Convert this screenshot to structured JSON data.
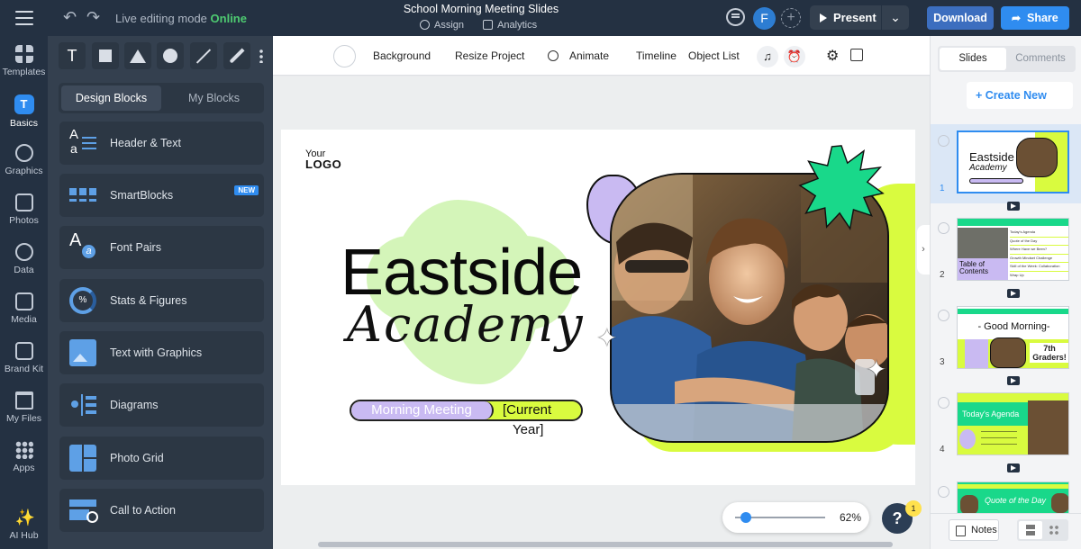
{
  "topbar": {
    "mode_text": "Live editing mode",
    "mode_status": "Online",
    "doc_title": "School Morning Meeting Slides",
    "assign_label": "Assign",
    "analytics_label": "Analytics",
    "avatar_initial": "F",
    "present_label": "Present",
    "download_label": "Download",
    "share_label": "Share"
  },
  "rail": {
    "items": [
      {
        "label": "Templates",
        "icon": "templates-icon"
      },
      {
        "label": "Basics",
        "icon": "basics-icon"
      },
      {
        "label": "Graphics",
        "icon": "graphics-icon"
      },
      {
        "label": "Photos",
        "icon": "photos-icon"
      },
      {
        "label": "Data",
        "icon": "data-icon"
      },
      {
        "label": "Media",
        "icon": "media-icon"
      },
      {
        "label": "Brand Kit",
        "icon": "brand-kit-icon"
      },
      {
        "label": "My Files",
        "icon": "folder-icon"
      },
      {
        "label": "Apps",
        "icon": "apps-icon"
      },
      {
        "label": "AI Hub",
        "icon": "sparkle-icon"
      }
    ]
  },
  "panel": {
    "text_tool": "T",
    "tabs": [
      "Design Blocks",
      "My Blocks"
    ],
    "blocks": [
      {
        "label": "Header & Text"
      },
      {
        "label": "SmartBlocks",
        "badge": "NEW"
      },
      {
        "label": "Font Pairs"
      },
      {
        "label": "Stats & Figures",
        "icon_text": "%"
      },
      {
        "label": "Text with Graphics"
      },
      {
        "label": "Diagrams"
      },
      {
        "label": "Photo Grid"
      },
      {
        "label": "Call to Action"
      }
    ]
  },
  "toolbar": {
    "background": "Background",
    "resize": "Resize Project",
    "animate": "Animate",
    "timeline": "Timeline",
    "object_list": "Object List"
  },
  "slide": {
    "logo_top": "Your",
    "logo_bottom": "LOGO",
    "title_line1": "Eastside",
    "title_line2": "Academy",
    "pill_left": "Morning Meeting",
    "pill_right_1": "[Current",
    "pill_right_2": "Year]"
  },
  "zoom": {
    "value": "62%",
    "level": 0.06
  },
  "help": {
    "label": "?",
    "badge": "1"
  },
  "right_panel": {
    "tabs": [
      "Slides",
      "Comments"
    ],
    "create_new": "+ Create New",
    "slides": [
      {
        "number": "1",
        "title": "Eastside",
        "subtitle": "Academy"
      },
      {
        "number": "2",
        "title": "Table of Contents",
        "items": [
          "Today's Agenda",
          "Quote of the Day",
          "Where Have we Been?",
          "Growth Mindset Challenge",
          "Skill of the Week: Collaboration",
          "Wrap Up"
        ]
      },
      {
        "number": "3",
        "title": "- Good Morning-",
        "subtitle": "7th Graders!"
      },
      {
        "number": "4",
        "title": "Today's Agenda"
      },
      {
        "number": "5",
        "title": "Quote of the Day"
      }
    ],
    "notes_label": "Notes"
  },
  "colors": {
    "topbar_bg": "#243142",
    "accent_blue": "#2f8cf0",
    "online_green": "#4ecb71",
    "lime": "#d9fb3f",
    "lavender": "#c9baf2",
    "mint": "#d4f5b9",
    "green_star": "#19d88a"
  }
}
